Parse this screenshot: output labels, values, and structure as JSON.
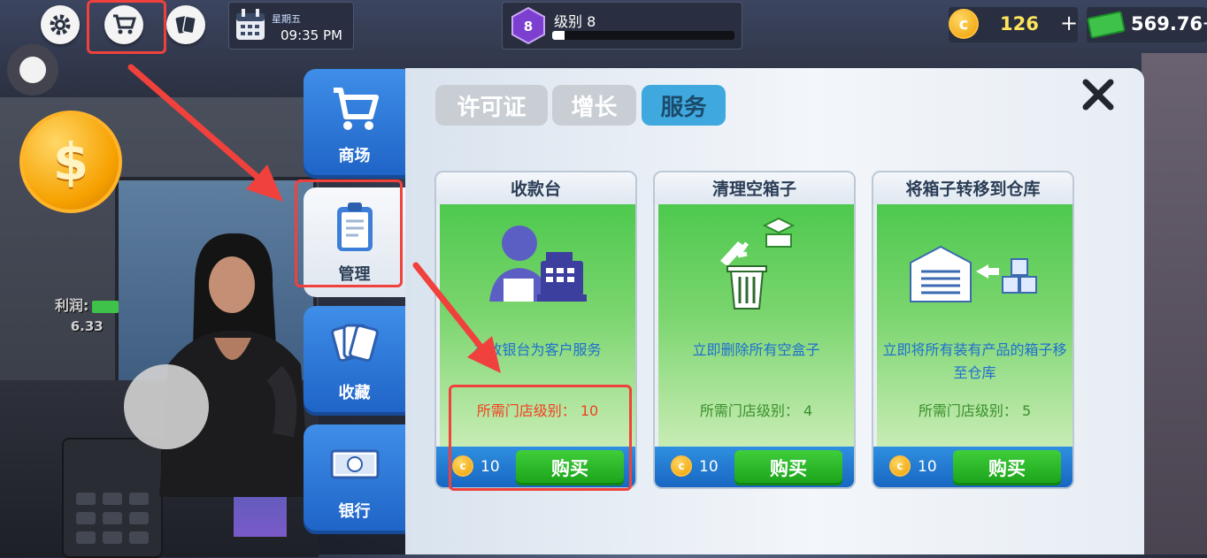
{
  "hud": {
    "day": "星期五",
    "time": "09:35 PM",
    "level_label": "级别 8",
    "level_number": "8",
    "level_progress": 0.07,
    "coins": "126",
    "coins_plus": "+",
    "cash": "569.76",
    "cash_plus": "+"
  },
  "world": {
    "profit_label": "利润:",
    "profit_value": "6.33",
    "coin_symbol": "$"
  },
  "side_menu": {
    "items": [
      {
        "label": "商场",
        "icon": "cart-icon"
      },
      {
        "label": "管理",
        "icon": "clipboard-icon"
      },
      {
        "label": "收藏",
        "icon": "cards-icon"
      },
      {
        "label": "银行",
        "icon": "cash-icon"
      }
    ],
    "active_index": 1
  },
  "panel": {
    "tabs": [
      {
        "label": "许可证"
      },
      {
        "label": "增长"
      },
      {
        "label": "服务"
      }
    ],
    "active_tab": 2,
    "cards": [
      {
        "title": "收款台",
        "description": "在收银台为客户服务",
        "requirement": "所需门店级别： 10",
        "price": "10",
        "buy_label": "购买",
        "icon": "cashier-icon",
        "locked": true
      },
      {
        "title": "清理空箱子",
        "description": "立即删除所有空盒子",
        "requirement": "所需门店级别： 4",
        "price": "10",
        "buy_label": "购买",
        "icon": "trash-boxes-icon",
        "locked": false
      },
      {
        "title": "将箱子转移到仓库",
        "description": "立即将所有装有产品的箱子移至仓库",
        "requirement": "所需门店级别： 5",
        "price": "10",
        "buy_label": "购买",
        "icon": "warehouse-icon",
        "locked": false
      }
    ]
  },
  "colors": {
    "highlight": "#f0413c",
    "menu_blue": "#1e63c6",
    "buy_green": "#1aa11a",
    "warn_text": "#f3401e"
  }
}
